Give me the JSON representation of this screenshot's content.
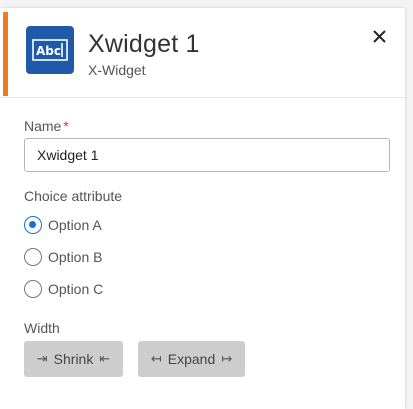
{
  "header": {
    "title": "Xwidget 1",
    "subtitle": "X-Widget",
    "icon_text": "Abc",
    "icon_name": "text-widget-icon",
    "accent_color": "#f07b1c",
    "icon_bg_color": "#1e5aa7"
  },
  "form": {
    "name_label": "Name",
    "name_required_marker": "*",
    "name_value": "Xwidget 1",
    "choice_label": "Choice attribute",
    "options": [
      {
        "label": "Option A",
        "selected": true
      },
      {
        "label": "Option B",
        "selected": false
      },
      {
        "label": "Option C",
        "selected": false
      }
    ],
    "width_label": "Width",
    "shrink_label": "Shrink",
    "expand_label": "Expand"
  }
}
